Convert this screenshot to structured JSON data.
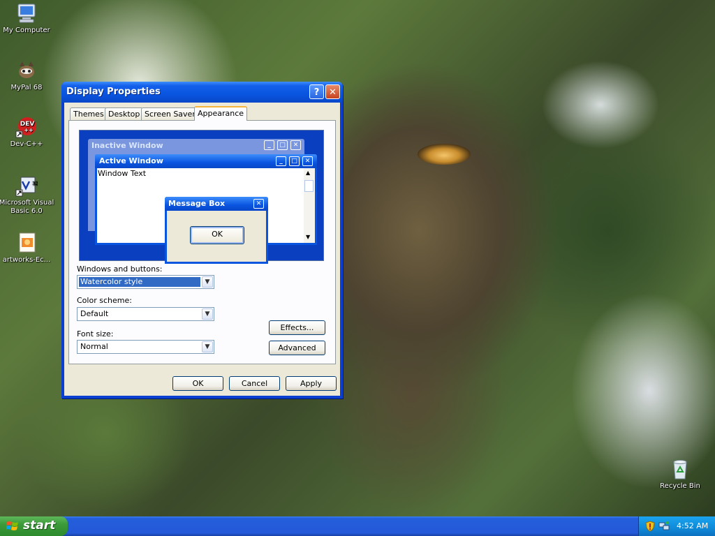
{
  "desktop_icons": [
    {
      "name": "my-computer-icon",
      "label": "My Computer"
    },
    {
      "name": "mypal-icon",
      "label": "MyPal 68"
    },
    {
      "name": "devcpp-icon",
      "label": "Dev-C++"
    },
    {
      "name": "vb6-icon",
      "label": "Microsoft Visual Basic 6.0"
    },
    {
      "name": "artworks-icon",
      "label": "artworks-Ec..."
    },
    {
      "name": "recycle-bin-icon",
      "label": "Recycle Bin"
    }
  ],
  "dialog": {
    "title": "Display Properties",
    "help_label": "?",
    "close_label": "✕",
    "tabs": [
      "Themes",
      "Desktop",
      "Screen Saver",
      "Appearance"
    ],
    "active_tab": "Appearance",
    "preview": {
      "inactive_title": "Inactive Window",
      "active_title": "Active Window",
      "window_text": "Window Text",
      "message_box_title": "Message Box",
      "message_box_ok": "OK"
    },
    "windows_and_buttons": {
      "label": "Windows and buttons:",
      "value": "Watercolor style"
    },
    "color_scheme": {
      "label": "Color scheme:",
      "value": "Default"
    },
    "font_size": {
      "label": "Font size:",
      "value": "Normal"
    },
    "effects_label": "Effects...",
    "advanced_label": "Advanced",
    "ok_label": "OK",
    "cancel_label": "Cancel",
    "apply_label": "Apply"
  },
  "taskbar": {
    "start_label": "start",
    "clock": "4:52 AM"
  },
  "colors": {
    "xp_blue": "#0a55e0",
    "start_green": "#3c9a3a",
    "dialog_face": "#ece9d8",
    "selection": "#316ac5"
  }
}
